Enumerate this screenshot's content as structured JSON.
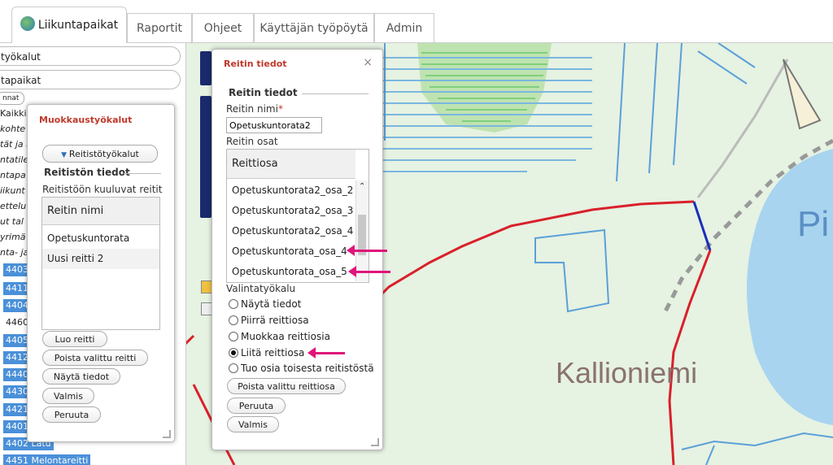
{
  "tabs": [
    {
      "label": "Liikuntapaikat",
      "active": true
    },
    {
      "label": "Raportit"
    },
    {
      "label": "Ohjeet"
    },
    {
      "label": "Käyttäjän työpöytä"
    },
    {
      "label": "Admin"
    }
  ],
  "left_panel": {
    "accordion1": "työkalut",
    "accordion2": "tapaikat",
    "small_pill": "nnat",
    "links": [
      "Kaikki",
      "kohte",
      "tät ja a",
      "ntatile",
      "ntapa",
      "iikunt",
      "ettelu",
      "ut tal",
      "yrimä",
      "nta- ja"
    ],
    "badges": [
      "4403",
      "4411",
      "4404",
      "4460",
      "4405",
      "4412",
      "4440",
      "4430",
      "4421",
      "4401",
      "4402 Latu",
      "4451 Melontareitti"
    ]
  },
  "muokkaus": {
    "title": "Muokkaustyökalut",
    "toggle_button": "Reitistötyökalut",
    "section": "Reitistön tiedot",
    "list_label": "Reitistöön kuuluvat reitit",
    "list_header": "Reitin nimi",
    "routes": [
      "Opetuskuntorata",
      "Uusi reitti 2"
    ],
    "buttons": [
      "Luo reitti",
      "Poista valittu reitti",
      "Näytä tiedot",
      "Valmis",
      "Peruuta"
    ]
  },
  "reitin": {
    "title": "Reitin tiedot",
    "close": "×",
    "section": "Reitin tiedot",
    "name_label": "Reitin nimi",
    "required_mark": "*",
    "name_value": "Opetuskuntorata2",
    "parts_label": "Reitin osat",
    "parts_header": "Reittiosa",
    "parts": [
      "Opetuskuntorata2_osa_2",
      "Opetuskuntorata2_osa_3",
      "Opetuskuntorata2_osa_4",
      "Opetuskuntorata_osa_4",
      "Opetuskuntorata_osa_5"
    ],
    "tool_label": "Valintatyökalu",
    "tools": [
      "Näytä tiedot",
      "Piirrä reittiosa",
      "Muokkaa reittiosia",
      "Liitä reittiosa",
      "Tuo osia toisesta reitistöstä"
    ],
    "selected_tool": 3,
    "buttons": [
      "Poista valittu reittiosa",
      "Peruuta",
      "Valmis"
    ]
  },
  "map": {
    "place_label": "Kallioniemi",
    "lake_label": "Pi"
  },
  "colors": {
    "accent": "#c0392b",
    "arrow": "#e0157a",
    "route": "#d9202a",
    "route_selected": "#1a2fb8"
  }
}
